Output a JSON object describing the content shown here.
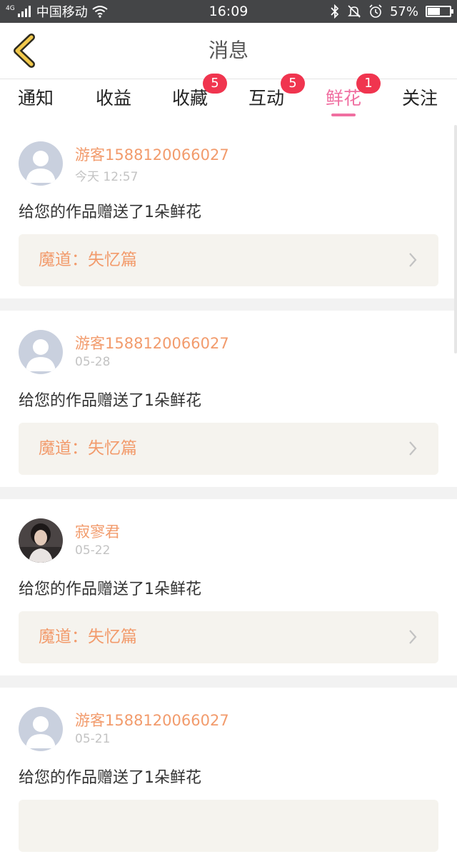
{
  "status_bar": {
    "net_tag": "4G",
    "carrier": "中国移动",
    "time": "16:09",
    "battery": "57%",
    "battery_level": 0.57,
    "icons": [
      "signal-icon",
      "wifi-icon",
      "bluetooth-icon",
      "mute-icon",
      "alarm-icon",
      "battery-icon"
    ]
  },
  "header": {
    "back_icon": "chevron-left-icon",
    "title": "消息"
  },
  "tabs": [
    {
      "label": "通知",
      "badge": null,
      "active": false
    },
    {
      "label": "收益",
      "badge": null,
      "active": false
    },
    {
      "label": "收藏",
      "badge": "5",
      "active": false
    },
    {
      "label": "互动",
      "badge": "5",
      "active": false
    },
    {
      "label": "鲜花",
      "badge": "1",
      "active": true
    },
    {
      "label": "关注",
      "badge": null,
      "active": false
    }
  ],
  "colors": {
    "accent": "#f06fa1",
    "badge": "#f0354f",
    "username": "#f29b6c",
    "status_bar": "#444547"
  },
  "items": [
    {
      "user": "游客1588120066027",
      "time": "今天 12:57",
      "message": "给您的作品赠送了1朵鲜花",
      "work": "魔道：失忆篇",
      "avatar": "default-avatar-icon"
    },
    {
      "user": "游客1588120066027",
      "time": "05-28",
      "message": "给您的作品赠送了1朵鲜花",
      "work": "魔道：失忆篇",
      "avatar": "default-avatar-icon"
    },
    {
      "user": "寂寥君",
      "time": "05-22",
      "message": "给您的作品赠送了1朵鲜花",
      "work": "魔道：失忆篇",
      "avatar": "user-photo-avatar"
    },
    {
      "user": "游客1588120066027",
      "time": "05-21",
      "message": "给您的作品赠送了1朵鲜花",
      "work": "",
      "avatar": "default-avatar-icon"
    }
  ]
}
